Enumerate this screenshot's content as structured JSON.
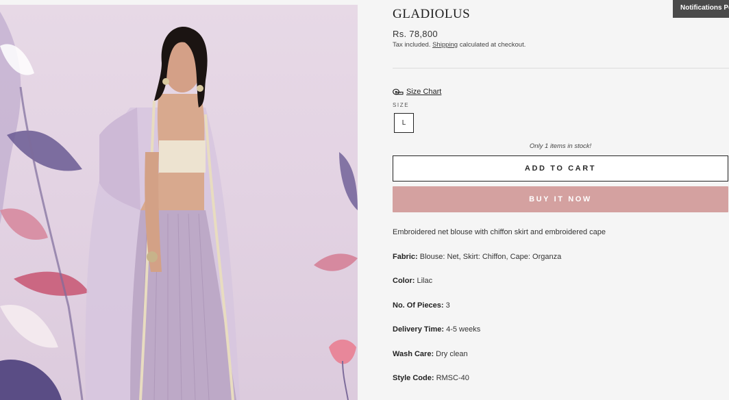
{
  "product": {
    "title": "GLADIOLUS",
    "price": "Rs. 78,800",
    "tax_prefix": "Tax included.",
    "shipping_link": "Shipping",
    "tax_suffix": "calculated at checkout.",
    "size_chart_label": "Size Chart",
    "size_heading": "SIZE",
    "sizes": [
      "L"
    ],
    "stock_note": "Only 1 items in stock!",
    "add_to_cart": "ADD TO CART",
    "buy_now": "BUY IT NOW",
    "description": "Embroidered net blouse with chiffon skirt and embroidered cape",
    "specs": [
      {
        "key": "Fabric:",
        "value": "Blouse: Net, Skirt: Chiffon, Cape: Organza"
      },
      {
        "key": "Color:",
        "value": "Lilac"
      },
      {
        "key": "No. Of Pieces:",
        "value": "3"
      },
      {
        "key": "Delivery Time:",
        "value": "4-5 weeks"
      },
      {
        "key": "Wash Care:",
        "value": "Dry clean"
      },
      {
        "key": "Style Code:",
        "value": "RMSC-40"
      }
    ]
  },
  "notification_tab": "Notifications Po",
  "colors": {
    "buy_button": "#d4a1a0",
    "background": "#f5f5f5",
    "notification_bg": "#4a4a4a"
  },
  "icons": {
    "size_chart": "measuring-tape-icon"
  }
}
